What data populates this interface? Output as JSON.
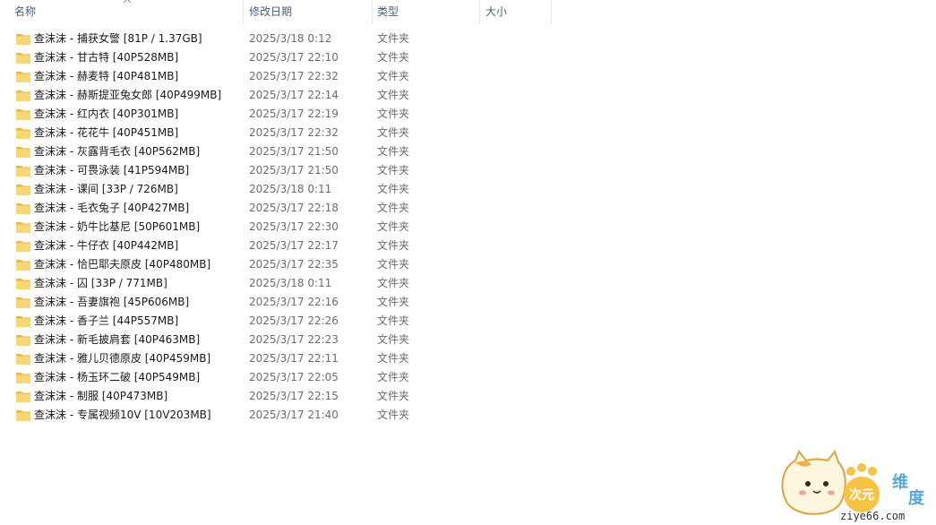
{
  "columns": {
    "name": "名称",
    "date": "修改日期",
    "type": "类型",
    "size": "大小"
  },
  "icons": {
    "folder": "folder-icon",
    "sort": "sort-ascending-icon"
  },
  "colors": {
    "folder_body": "#f8d775",
    "folder_tab": "#e8b74a",
    "header_text": "#4c607a"
  },
  "files": [
    {
      "name": "查沫沫 - 捕获女警 [81P / 1.37GB]",
      "date": "2025/3/18 0:12",
      "type": "文件夹"
    },
    {
      "name": "查沫沫 - 甘古特 [40P528MB]",
      "date": "2025/3/17 22:10",
      "type": "文件夹"
    },
    {
      "name": "查沫沫 - 赫麦特 [40P481MB]",
      "date": "2025/3/17 22:32",
      "type": "文件夹"
    },
    {
      "name": "查沫沫 - 赫斯提亚兔女郎 [40P499MB]",
      "date": "2025/3/17 22:14",
      "type": "文件夹"
    },
    {
      "name": "查沫沫 - 红内衣 [40P301MB]",
      "date": "2025/3/17 22:19",
      "type": "文件夹"
    },
    {
      "name": "查沫沫 - 花花牛 [40P451MB]",
      "date": "2025/3/17 22:32",
      "type": "文件夹"
    },
    {
      "name": "查沫沫 - 灰露背毛衣 [40P562MB]",
      "date": "2025/3/17 21:50",
      "type": "文件夹"
    },
    {
      "name": "查沫沫 - 可畏泳装 [41P594MB]",
      "date": "2025/3/17 21:50",
      "type": "文件夹"
    },
    {
      "name": "查沫沫 - 课间 [33P / 726MB]",
      "date": "2025/3/18 0:11",
      "type": "文件夹"
    },
    {
      "name": "查沫沫 - 毛衣兔子 [40P427MB]",
      "date": "2025/3/17 22:18",
      "type": "文件夹"
    },
    {
      "name": "查沫沫 - 奶牛比基尼 [50P601MB]",
      "date": "2025/3/17 22:30",
      "type": "文件夹"
    },
    {
      "name": "查沫沫 - 牛仔衣 [40P442MB]",
      "date": "2025/3/17 22:17",
      "type": "文件夹"
    },
    {
      "name": "查沫沫 - 恰巴耶夫原皮 [40P480MB]",
      "date": "2025/3/17 22:35",
      "type": "文件夹"
    },
    {
      "name": "查沫沫 - 囚 [33P / 771MB]",
      "date": "2025/3/18 0:11",
      "type": "文件夹"
    },
    {
      "name": "查沫沫 - 吾妻旗袍 [45P606MB]",
      "date": "2025/3/17 22:16",
      "type": "文件夹"
    },
    {
      "name": "查沫沫 - 香子兰 [44P557MB]",
      "date": "2025/3/17 22:26",
      "type": "文件夹"
    },
    {
      "name": "查沫沫 - 新毛披肩套 [40P463MB]",
      "date": "2025/3/17 22:23",
      "type": "文件夹"
    },
    {
      "name": "查沫沫 - 雅儿贝德原皮 [40P459MB]",
      "date": "2025/3/17 22:11",
      "type": "文件夹"
    },
    {
      "name": "查沫沫 - 杨玉环二破 [40P549MB]",
      "date": "2025/3/17 22:05",
      "type": "文件夹"
    },
    {
      "name": "查沫沫 - 制服 [40P473MB]",
      "date": "2025/3/17 22:15",
      "type": "文件夹"
    },
    {
      "name": "查沫沫 - 专属视频10V [10V203MB]",
      "date": "2025/3/17 21:40",
      "type": "文件夹"
    }
  ],
  "watermark": {
    "brand_cn_1": "次元",
    "brand_cn_2": "维",
    "brand_cn_3": "度",
    "domain": "ziye66.com"
  }
}
